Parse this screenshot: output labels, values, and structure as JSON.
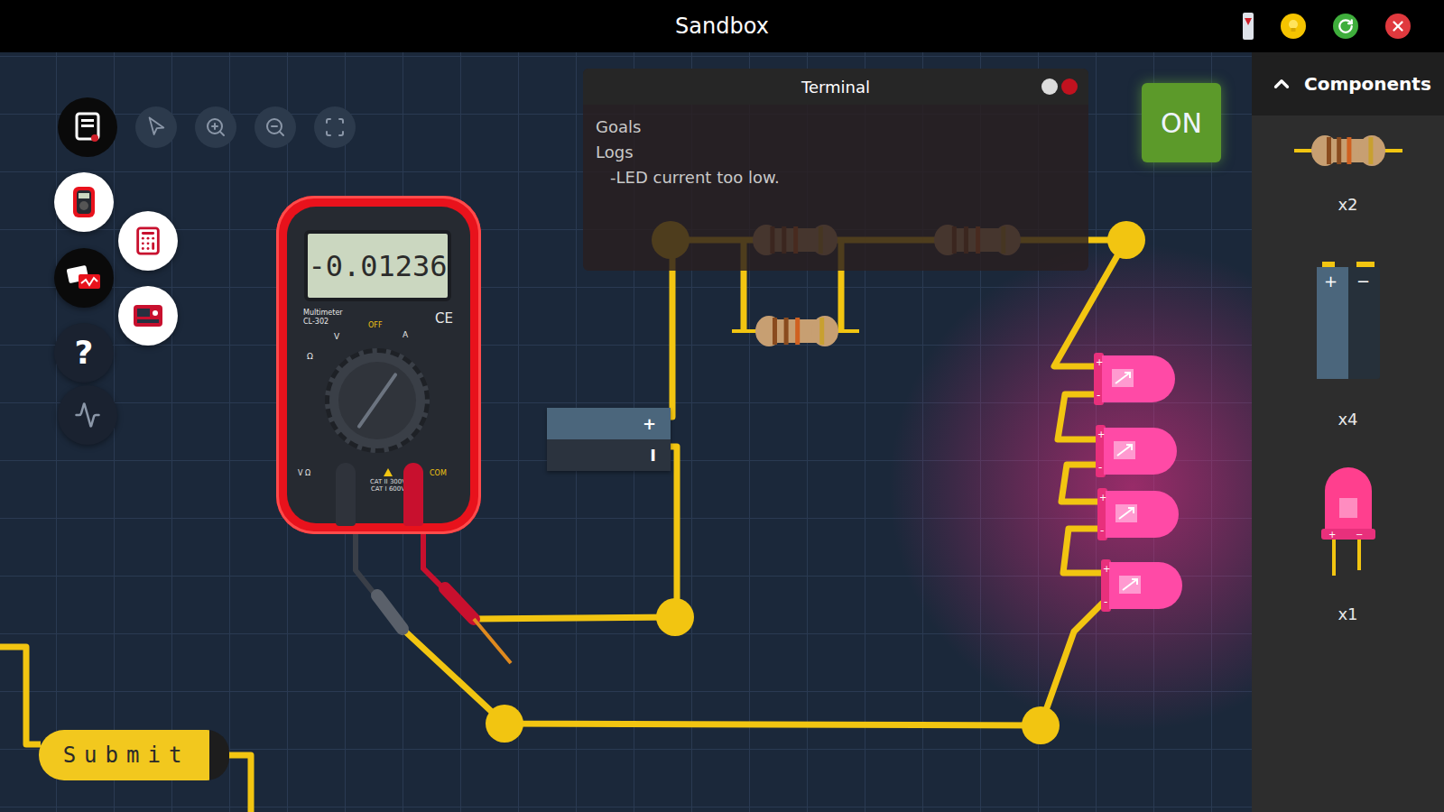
{
  "window": {
    "title": "Sandbox"
  },
  "toolbar": {
    "help_label": "?"
  },
  "terminal": {
    "title": "Terminal",
    "sections": [
      "Goals",
      "Logs"
    ],
    "logs": [
      "-LED current too low."
    ]
  },
  "power_button": {
    "label": "ON",
    "on": true
  },
  "multimeter": {
    "reading": "-0.01236",
    "brand": "Multimeter",
    "model": "CL-302",
    "dial_labels": {
      "off": "OFF",
      "volt": "V",
      "amp": "A",
      "ohm": "Ω"
    },
    "mark": "CE",
    "ratings": [
      "CAT II 300V",
      "CAT I 600V"
    ],
    "jacks": [
      {
        "label": "V Ω",
        "color": "#2f333b"
      },
      {
        "label": "COM",
        "color": "#c8102e"
      }
    ]
  },
  "battery": {
    "plus": "+",
    "minus": "I"
  },
  "leds": [
    {
      "lit": true,
      "plus": "+",
      "minus": "-"
    },
    {
      "lit": true,
      "plus": "+",
      "minus": "-"
    },
    {
      "lit": true,
      "plus": "+",
      "minus": "-"
    },
    {
      "lit": true,
      "plus": "+",
      "minus": "-"
    }
  ],
  "submit": {
    "label": "Submit"
  },
  "components_panel": {
    "title": "Components",
    "expanded": true,
    "items": [
      {
        "kind": "resistor",
        "count": "x2"
      },
      {
        "kind": "battery",
        "count": "x4",
        "plus": "+",
        "minus": "−"
      },
      {
        "kind": "led",
        "count": "x1",
        "plus": "+",
        "minus": "−"
      }
    ]
  }
}
